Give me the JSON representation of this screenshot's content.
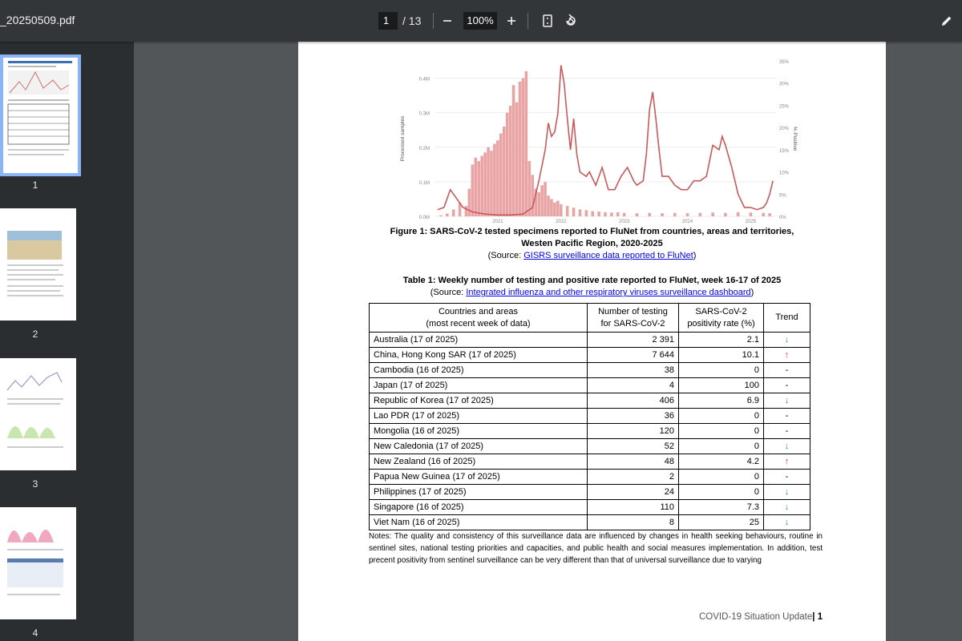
{
  "toolbar": {
    "filename": "_20250509.pdf",
    "page_current": "1",
    "page_total": "/ 13",
    "zoom": "100%",
    "zoom_out_icon": "minus-icon",
    "zoom_in_icon": "plus-icon",
    "fit_icon": "fit-page-icon",
    "rotate_icon": "rotate-icon",
    "edit_icon": "pencil-icon"
  },
  "sidebar": {
    "thumbnails": [
      {
        "label": "1",
        "selected": true
      },
      {
        "label": "2",
        "selected": false
      },
      {
        "label": "3",
        "selected": false
      },
      {
        "label": "4",
        "selected": false
      }
    ]
  },
  "document": {
    "figure_caption_line1": "Figure 1: SARS-CoV-2 tested specimens reported to FluNet from countries, areas and territories,",
    "figure_caption_line2": "Westen Pacific Region, 2020-2025",
    "figure_source_prefix": "(Source: ",
    "figure_source_link": "GISRS surveillance data reported to FluNet",
    "figure_source_suffix": ")",
    "table_title": "Table 1: Weekly number of testing and positive rate reported to FluNet, week 16-17 of 2025",
    "table_source_prefix": "(Source: ",
    "table_source_link": "Integrated influenza and other respiratory viruses surveillance dashboard",
    "table_source_suffix": ")",
    "table_headers": {
      "col1_line1": "Countries and areas",
      "col1_line2": "(most recent week of data)",
      "col2_line1": "Number of testing",
      "col2_line2": "for SARS-CoV-2",
      "col3_line1": "SARS-CoV-2",
      "col3_line2": "positivity rate (%)",
      "col4": "Trend"
    },
    "rows": [
      {
        "country": "Australia (17 of 2025)",
        "tests": "2 391",
        "rate": "2.1",
        "trend": "↓"
      },
      {
        "country": "China, Hong Kong SAR (17 of 2025)",
        "tests": "7 644",
        "rate": "10.1",
        "trend": "↑"
      },
      {
        "country": "Cambodia (16 of 2025)",
        "tests": "38",
        "rate": "0",
        "trend": "-"
      },
      {
        "country": "Japan (17 of 2025)",
        "tests": "4",
        "rate": "100",
        "trend": "-"
      },
      {
        "country": "Republic of Korea (17 of 2025)",
        "tests": "406",
        "rate": "6.9",
        "trend": "↓"
      },
      {
        "country": "Lao PDR (17 of 2025)",
        "tests": "36",
        "rate": "0",
        "trend": "-"
      },
      {
        "country": "Mongolia (16 of 2025)",
        "tests": "120",
        "rate": "0",
        "trend": "-"
      },
      {
        "country": "New Caledonia (17 of 2025)",
        "tests": "52",
        "rate": "0",
        "trend": "↓"
      },
      {
        "country": "New Zealand (16 of 2025)",
        "tests": "48",
        "rate": "4.2",
        "trend": "↑"
      },
      {
        "country": "Papua New Guinea (17 of 2025)",
        "tests": "2",
        "rate": "0",
        "trend": "-"
      },
      {
        "country": "Philippines (17 of 2025)",
        "tests": "24",
        "rate": "0",
        "trend": "↓"
      },
      {
        "country": "Singapore (16 of 2025)",
        "tests": "110",
        "rate": "7.3",
        "trend": "↓"
      },
      {
        "country": "Viet Nam (16 of 2025)",
        "tests": "8",
        "rate": "25",
        "trend": "↓"
      }
    ],
    "notes": "Notes: The quality and consistency of this surveillance data are influenced by changes in health seeking behaviours, routine in sentinel sites, national testing priorities and capacities, and public health and social measures implementation. In addition, test precent positivity from sentinel surveillance can be very different than that of universal surveillance due to varying",
    "footer_text": "COVID-19 Situation Update",
    "footer_sep": "|",
    "footer_page": "1"
  },
  "chart_data": {
    "type": "bar",
    "title": "",
    "ylabel": "Processed samples",
    "y2label": "% Positive",
    "ylim": [
      0,
      450000
    ],
    "y2lim": [
      0,
      35
    ],
    "y_ticks": [
      "0.0M",
      "0.1M",
      "0.2M",
      "0.3M",
      "0.4M"
    ],
    "y2_ticks": [
      "0%",
      "5%",
      "10%",
      "15%",
      "20%",
      "25%",
      "30%",
      "35%"
    ],
    "x_ticks": [
      "2021",
      "2022",
      "2023",
      "2024",
      "2025"
    ],
    "x_start": 2020.0,
    "x_end": 2025.4,
    "series": [
      {
        "name": "Processed samples",
        "kind": "bar",
        "color": "#e8a3a3",
        "points": [
          [
            2020.1,
            3000
          ],
          [
            2020.2,
            8000
          ],
          [
            2020.3,
            20000
          ],
          [
            2020.4,
            40000
          ],
          [
            2020.5,
            30000
          ],
          [
            2020.55,
            80000
          ],
          [
            2020.6,
            150000
          ],
          [
            2020.65,
            170000
          ],
          [
            2020.7,
            160000
          ],
          [
            2020.75,
            175000
          ],
          [
            2020.8,
            185000
          ],
          [
            2020.85,
            200000
          ],
          [
            2020.9,
            190000
          ],
          [
            2020.95,
            210000
          ],
          [
            2021.0,
            220000
          ],
          [
            2021.05,
            240000
          ],
          [
            2021.1,
            260000
          ],
          [
            2021.15,
            300000
          ],
          [
            2021.2,
            320000
          ],
          [
            2021.25,
            380000
          ],
          [
            2021.3,
            330000
          ],
          [
            2021.35,
            390000
          ],
          [
            2021.4,
            400000
          ],
          [
            2021.45,
            420000
          ],
          [
            2021.5,
            160000
          ],
          [
            2021.55,
            120000
          ],
          [
            2021.6,
            80000
          ],
          [
            2021.65,
            70000
          ],
          [
            2021.7,
            90000
          ],
          [
            2021.75,
            100000
          ],
          [
            2021.8,
            60000
          ],
          [
            2021.85,
            50000
          ],
          [
            2021.9,
            40000
          ],
          [
            2021.95,
            45000
          ],
          [
            2022.0,
            35000
          ],
          [
            2022.1,
            30000
          ],
          [
            2022.2,
            25000
          ],
          [
            2022.3,
            20000
          ],
          [
            2022.4,
            18000
          ],
          [
            2022.5,
            15000
          ],
          [
            2022.6,
            14000
          ],
          [
            2022.7,
            12000
          ],
          [
            2022.8,
            11000
          ],
          [
            2022.9,
            12000
          ],
          [
            2023.0,
            10000
          ],
          [
            2023.2,
            9000
          ],
          [
            2023.4,
            10000
          ],
          [
            2023.6,
            9000
          ],
          [
            2023.8,
            10000
          ],
          [
            2024.0,
            9500
          ],
          [
            2024.2,
            10000
          ],
          [
            2024.4,
            11000
          ],
          [
            2024.6,
            10000
          ],
          [
            2024.8,
            12000
          ],
          [
            2025.0,
            11000
          ],
          [
            2025.2,
            10000
          ],
          [
            2025.3,
            9000
          ]
        ]
      },
      {
        "name": "% Positive",
        "kind": "line",
        "color": "#c9595b",
        "points": [
          [
            2020.05,
            1.5
          ],
          [
            2020.15,
            2
          ],
          [
            2020.25,
            6
          ],
          [
            2020.35,
            4
          ],
          [
            2020.45,
            2
          ],
          [
            2020.6,
            1
          ],
          [
            2020.8,
            0.5
          ],
          [
            2021.0,
            0.3
          ],
          [
            2021.2,
            0.3
          ],
          [
            2021.4,
            0.5
          ],
          [
            2021.55,
            2
          ],
          [
            2021.65,
            8
          ],
          [
            2021.75,
            15
          ],
          [
            2021.8,
            21
          ],
          [
            2021.85,
            18
          ],
          [
            2021.9,
            19
          ],
          [
            2021.95,
            23
          ],
          [
            2022.0,
            34
          ],
          [
            2022.05,
            30
          ],
          [
            2022.1,
            22
          ],
          [
            2022.15,
            15
          ],
          [
            2022.2,
            22
          ],
          [
            2022.25,
            14
          ],
          [
            2022.3,
            10
          ],
          [
            2022.4,
            9
          ],
          [
            2022.45,
            10
          ],
          [
            2022.55,
            7
          ],
          [
            2022.65,
            11
          ],
          [
            2022.75,
            6
          ],
          [
            2022.85,
            6
          ],
          [
            2022.95,
            9
          ],
          [
            2023.05,
            11
          ],
          [
            2023.15,
            8
          ],
          [
            2023.2,
            7
          ],
          [
            2023.3,
            8
          ],
          [
            2023.35,
            14
          ],
          [
            2023.4,
            24
          ],
          [
            2023.45,
            28
          ],
          [
            2023.5,
            22
          ],
          [
            2023.55,
            15
          ],
          [
            2023.6,
            9
          ],
          [
            2023.7,
            9
          ],
          [
            2023.8,
            7
          ],
          [
            2023.9,
            6
          ],
          [
            2024.0,
            6
          ],
          [
            2024.1,
            8
          ],
          [
            2024.2,
            8
          ],
          [
            2024.3,
            9
          ],
          [
            2024.4,
            16
          ],
          [
            2024.5,
            15
          ],
          [
            2024.55,
            18
          ],
          [
            2024.6,
            16
          ],
          [
            2024.7,
            11
          ],
          [
            2024.8,
            5
          ],
          [
            2024.9,
            2
          ],
          [
            2025.0,
            2
          ],
          [
            2025.1,
            1.5
          ],
          [
            2025.2,
            2
          ],
          [
            2025.25,
            3
          ],
          [
            2025.3,
            5
          ],
          [
            2025.35,
            8
          ]
        ]
      }
    ]
  }
}
